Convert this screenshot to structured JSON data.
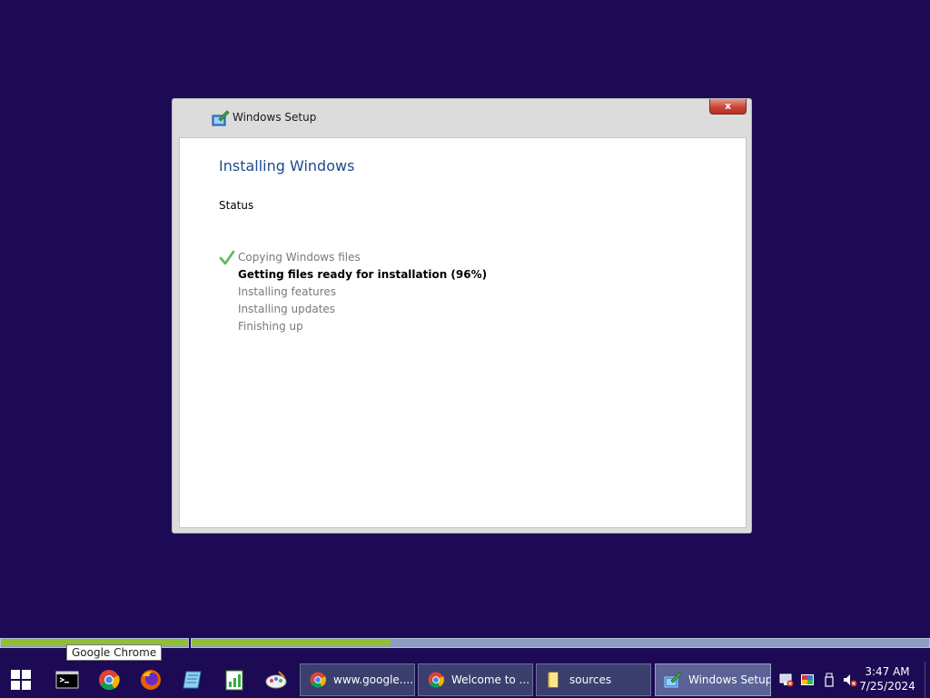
{
  "window": {
    "title": "Windows Setup",
    "close_label": "x",
    "heading": "Installing Windows",
    "status_label": "Status",
    "steps": [
      {
        "label": "Copying Windows files",
        "state": "done"
      },
      {
        "label": "Getting files ready for installation (96%)",
        "state": "active"
      },
      {
        "label": "Installing features",
        "state": "pending"
      },
      {
        "label": "Installing updates",
        "state": "pending"
      },
      {
        "label": "Finishing up",
        "state": "pending"
      }
    ]
  },
  "progress": {
    "segment_1_fraction": 1.0,
    "segment_2_fraction": 0.27,
    "fill_color": "#8fbf3a",
    "track_color": "#8a9cc0"
  },
  "tooltip": {
    "text": "Google Chrome"
  },
  "taskbar": {
    "pinned": [
      {
        "name": "start-icon"
      },
      {
        "name": "command-prompt-icon"
      },
      {
        "name": "chrome-icon"
      },
      {
        "name": "firefox-icon"
      },
      {
        "name": "notepad-icon"
      },
      {
        "name": "spreadsheet-icon"
      },
      {
        "name": "paint-icon"
      }
    ],
    "apps": [
      {
        "label": "www.google....",
        "icon": "chrome-icon"
      },
      {
        "label": "Welcome to ...",
        "icon": "chrome-icon"
      },
      {
        "label": "sources",
        "icon": "folder-icon"
      },
      {
        "label": "Windows Setup",
        "icon": "setup-icon",
        "active": true
      }
    ],
    "tray": [
      "network-icon",
      "color-icon",
      "usb-icon",
      "volume-muted-icon"
    ],
    "time": "3:47 AM",
    "date": "7/25/2024"
  },
  "colors": {
    "desktop": "#1c0a55",
    "heading": "#1e4b8f",
    "check": "#5cb85c"
  }
}
